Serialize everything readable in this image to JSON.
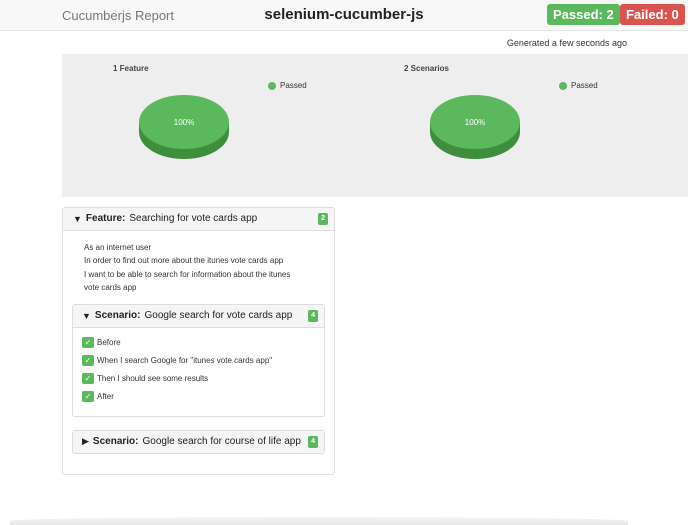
{
  "header": {
    "brand": "Cucumberjs Report",
    "title": "selenium-cucumber-js",
    "passed_badge": "Passed: 2",
    "failed_badge": "Failed: 0"
  },
  "generated": "Generated a few seconds ago",
  "charts": [
    {
      "title": "1 Feature",
      "legend": "Passed",
      "slice_label": "100%"
    },
    {
      "title": "2 Scenarios",
      "legend": "Passed",
      "slice_label": "100%"
    }
  ],
  "chart_data": [
    {
      "type": "pie",
      "title": "1 Feature",
      "categories": [
        "Passed"
      ],
      "values": [
        1
      ],
      "labels": [
        "100%"
      ],
      "colors": [
        "#5cb85c"
      ],
      "legend": "top-right"
    },
    {
      "type": "pie",
      "title": "2 Scenarios",
      "categories": [
        "Passed"
      ],
      "values": [
        2
      ],
      "labels": [
        "100%"
      ],
      "colors": [
        "#5cb85c"
      ],
      "legend": "top-right"
    }
  ],
  "feature": {
    "keyword": "Feature:",
    "name": "Searching for vote cards app",
    "count": "2",
    "description": [
      "As an internet user",
      "In order to find out more about the itunes vote cards app",
      "I want to be able to search for information about the itunes",
      "vote cards app"
    ]
  },
  "scenarios": [
    {
      "keyword": "Scenario:",
      "name": "Google search for vote cards app",
      "count": "4",
      "expanded": true,
      "steps": [
        "Before",
        "When I search Google for \"itunes vote cards app\"",
        "Then I should see some results",
        "After"
      ]
    },
    {
      "keyword": "Scenario:",
      "name": "Google search for course of life app",
      "count": "4",
      "expanded": false
    }
  ],
  "colors": {
    "passed": "#5cb85c",
    "failed": "#d9534f"
  },
  "icons": {
    "expanded": "chevron-down-icon",
    "collapsed": "chevron-right-icon",
    "step": "check-icon"
  }
}
